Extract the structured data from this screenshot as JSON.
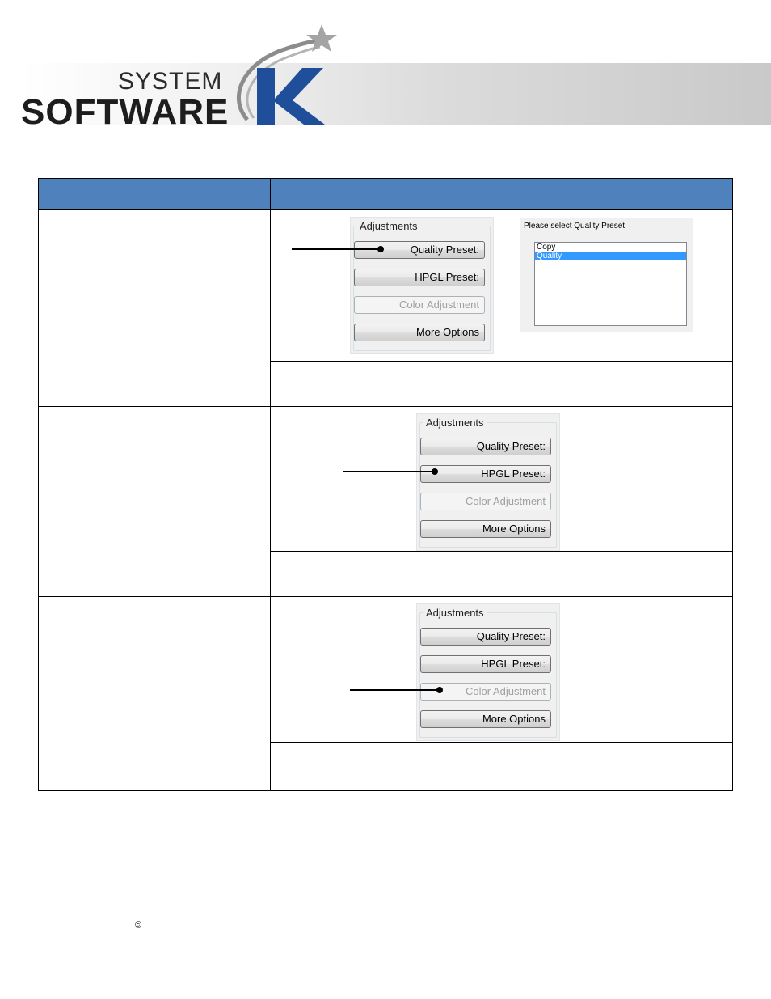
{
  "logo": {
    "system": "SYSTEM",
    "software": "SOFTWARE",
    "mark_letter": "K",
    "brand_blue": "#1f4e9a",
    "star_color": "#9a9a9a"
  },
  "table_header_color": "#4f81bd",
  "panel": {
    "title": "Adjustments",
    "buttons": [
      "Quality Preset:",
      "HPGL Preset:",
      "Color Adjustment",
      "More Options"
    ]
  },
  "dialog": {
    "title": "Please select Quality Preset",
    "items": [
      "Copy",
      "Quality"
    ],
    "selected_index": 1
  },
  "footer": {
    "copyright_symbol": "©"
  }
}
